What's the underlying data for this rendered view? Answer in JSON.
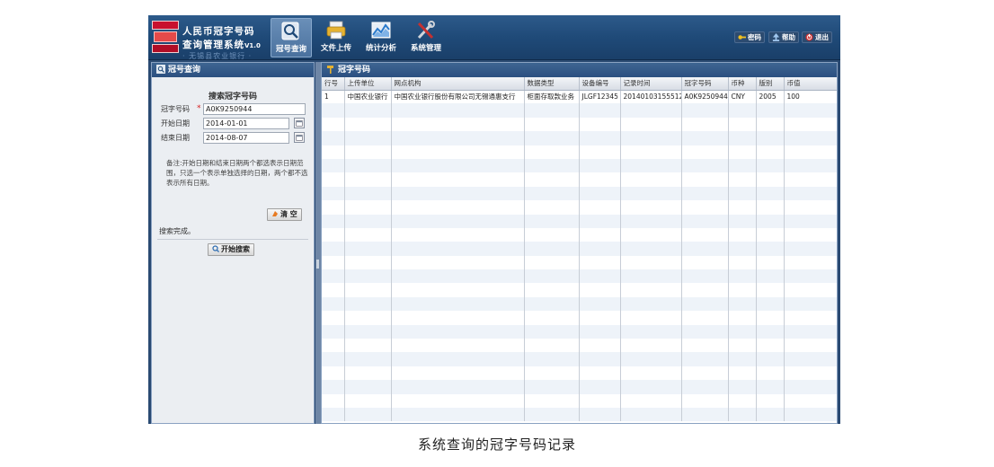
{
  "header": {
    "title_line1": "人民币冠字号码",
    "title_line2": "查询管理系统",
    "version": "V1.0",
    "title_line3": "· 无锡县农业银行 ·",
    "nav": [
      {
        "label": "冠号查询",
        "icon": "magnifier-icon",
        "active": true
      },
      {
        "label": "文件上传",
        "icon": "upload-printer-icon",
        "active": false
      },
      {
        "label": "统计分析",
        "icon": "chart-icon",
        "active": false
      },
      {
        "label": "系统管理",
        "icon": "tools-icon",
        "active": false
      }
    ],
    "top_buttons": [
      {
        "label": "密码",
        "icon": "key-icon"
      },
      {
        "label": "帮助",
        "icon": "help-icon"
      },
      {
        "label": "退出",
        "icon": "power-icon"
      }
    ]
  },
  "left_panel": {
    "title": "冠号查询",
    "search_title": "搜索冠字号码",
    "fields": {
      "serial_label": "冠字号码",
      "serial_value": "A0K9250944",
      "required_mark": "*",
      "start_label": "开始日期",
      "start_value": "2014-01-01",
      "end_label": "结束日期",
      "end_value": "2014-08-07"
    },
    "note": "备注:开始日期和结束日期两个都选表示日期范围，只选一个表示单独选择的日期，两个都不选表示所有日期。",
    "clear_button": "清 空",
    "status": "搜索完成。",
    "search_button": "开始搜索"
  },
  "right_panel": {
    "title": "冠字号码",
    "columns": [
      "行号",
      "上传单位",
      "网点机构",
      "数据类型",
      "设备编号",
      "记录时间",
      "冠字号码",
      "币种",
      "版别",
      "币值"
    ],
    "rows": [
      [
        "1",
        "中国农业银行",
        "中国农业银行股份有限公司无锡通惠支行",
        "柜面存取款业务",
        "JLGF12345",
        "20140103155512",
        "A0K9250944",
        "CNY",
        "2005",
        "100"
      ]
    ]
  },
  "caption": "系统查询的冠字号码记录",
  "colors": {
    "header": "#1f4a78",
    "panel_head": "#2b5080",
    "row_alt": "#eef3f9"
  }
}
